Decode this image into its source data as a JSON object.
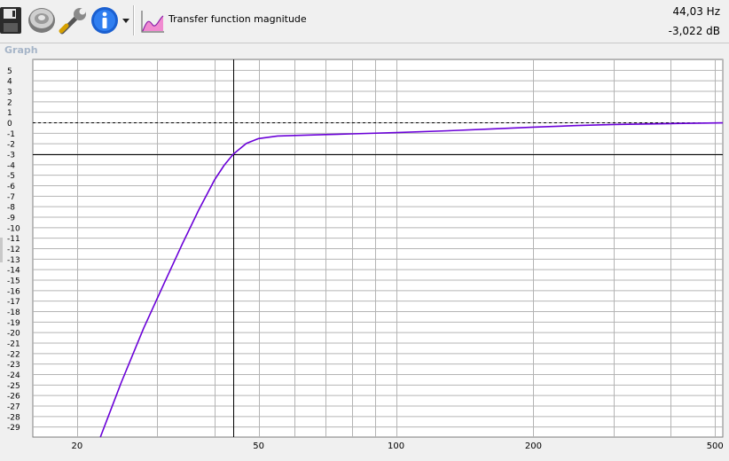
{
  "toolbar": {
    "items": [
      {
        "name": "save-icon"
      },
      {
        "name": "driver-icon"
      },
      {
        "name": "tools-icon"
      },
      {
        "name": "info-icon"
      },
      {
        "name": "dropdown-arrow-icon"
      },
      {
        "name": "transfer-function-icon"
      }
    ],
    "view_label": "Transfer function magnitude"
  },
  "readout": {
    "frequency": "44,03 Hz",
    "level": "-3,022 dB"
  },
  "graph": {
    "title": "Graph"
  },
  "colors": {
    "curve": "#6a00d8",
    "grid": "#b4b4b4",
    "plot_bg": "#ffffff",
    "cursor": "#000000"
  },
  "chart_data": {
    "type": "line",
    "title": "Transfer function magnitude",
    "xlabel": "",
    "ylabel": "",
    "x_scale": "log",
    "xlim": [
      16,
      520
    ],
    "ylim": [
      -30,
      6
    ],
    "x_tick_labels": [
      "20",
      "50",
      "100",
      "200",
      "500"
    ],
    "x_ticks": [
      20,
      50,
      100,
      200,
      500
    ],
    "y_ticks": [
      5,
      4,
      3,
      2,
      1,
      0,
      -1,
      -2,
      -3,
      -4,
      -5,
      -6,
      -7,
      -8,
      -9,
      -10,
      -11,
      -12,
      -13,
      -14,
      -15,
      -16,
      -17,
      -18,
      -19,
      -20,
      -21,
      -22,
      -23,
      -24,
      -25,
      -26,
      -27,
      -28,
      -29
    ],
    "grid": true,
    "series": [
      {
        "x": [
          22.5,
          25,
          28,
          31,
          34,
          37,
          40,
          42,
          44.03,
          47,
          50,
          55,
          60,
          70,
          80,
          100,
          130,
          160,
          200,
          250,
          300,
          400,
          520
        ],
        "values": [
          -30,
          -24.8,
          -19.6,
          -15.4,
          -11.6,
          -8.3,
          -5.5,
          -4.1,
          -3.02,
          -2.0,
          -1.55,
          -1.3,
          -1.25,
          -1.17,
          -1.1,
          -0.98,
          -0.8,
          -0.64,
          -0.46,
          -0.3,
          -0.2,
          -0.12,
          -0.05
        ]
      }
    ],
    "cursor": {
      "x": 44.03,
      "y": -3.022
    },
    "reference_line_y": 0
  }
}
